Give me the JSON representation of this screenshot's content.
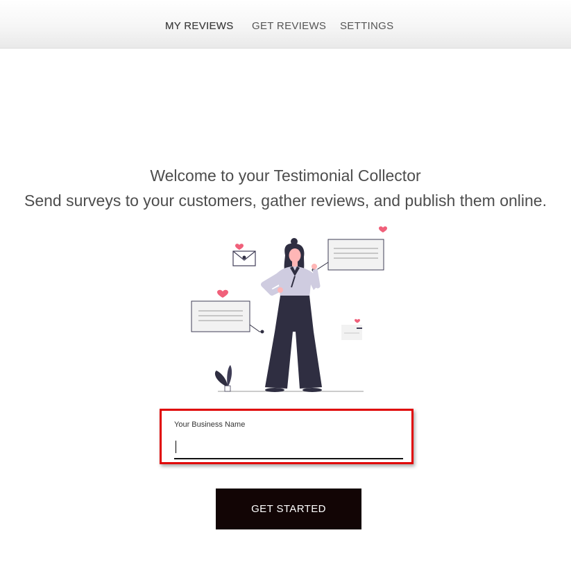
{
  "nav": {
    "items": [
      {
        "label": "MY REVIEWS",
        "active": true
      },
      {
        "label": "GET REVIEWS",
        "active": false
      },
      {
        "label": "SETTINGS",
        "active": false
      }
    ]
  },
  "welcome": {
    "line1": "Welcome to your Testimonial Collector",
    "line2": "Send surveys to your customers, gather reviews, and publish them online."
  },
  "form": {
    "business_name_label": "Your Business Name",
    "business_name_value": ""
  },
  "cta": {
    "label": "GET STARTED"
  },
  "colors": {
    "highlight_border": "#e00000",
    "button_bg": "#120505",
    "heart": "#f0607a",
    "figure_dark": "#2f2e41",
    "figure_shirt": "#cfcce0"
  }
}
